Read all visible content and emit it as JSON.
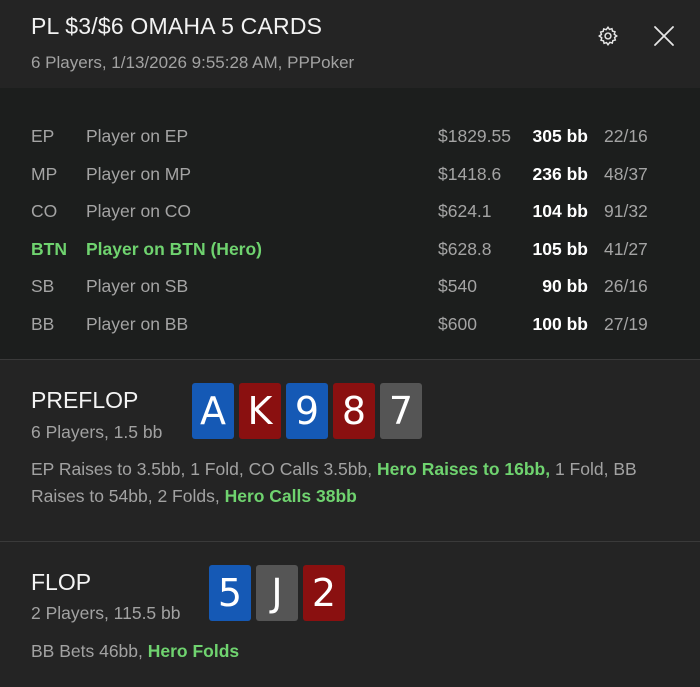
{
  "header": {
    "title": "PL $3/$6 OMAHA 5 CARDS",
    "subtitle": "6 Players, 1/13/2026 9:55:28 AM, PPPoker",
    "settings_icon": "gear-icon",
    "close_icon": "close-icon"
  },
  "players": [
    {
      "pos": "EP",
      "name": "Player on EP",
      "stack": "$1829.55",
      "bb": "305 bb",
      "stat": "22/16",
      "hero": false
    },
    {
      "pos": "MP",
      "name": "Player on MP",
      "stack": "$1418.6",
      "bb": "236 bb",
      "stat": "48/37",
      "hero": false
    },
    {
      "pos": "CO",
      "name": "Player on CO",
      "stack": "$624.1",
      "bb": "104 bb",
      "stat": "91/32",
      "hero": false
    },
    {
      "pos": "BTN",
      "name": "Player on BTN (Hero)",
      "stack": "$628.8",
      "bb": "105 bb",
      "stat": "41/27",
      "hero": true
    },
    {
      "pos": "SB",
      "name": "Player on SB",
      "stack": "$540",
      "bb": "90 bb",
      "stat": "26/16",
      "hero": false
    },
    {
      "pos": "BB",
      "name": "Player on BB",
      "stack": "$600",
      "bb": "100 bb",
      "stat": "27/19",
      "hero": false
    }
  ],
  "colors": {
    "hero_green": "#6fd36f",
    "suit_diamonds": "#1559b5",
    "suit_hearts": "#8a1010",
    "suit_spades": "#555555"
  },
  "streets": {
    "preflop": {
      "name": "PREFLOP",
      "info": "6 Players, 1.5 bb",
      "cards": [
        {
          "rank": "A",
          "suit": "d"
        },
        {
          "rank": "K",
          "suit": "h"
        },
        {
          "rank": "9",
          "suit": "d"
        },
        {
          "rank": "8",
          "suit": "h"
        },
        {
          "rank": "7",
          "suit": "s"
        }
      ],
      "actions": [
        {
          "text": "EP Raises to 3.5bb, 1 Fold, CO Calls 3.5bb, ",
          "hero": false
        },
        {
          "text": "Hero Raises to 16bb,",
          "hero": true
        },
        {
          "text": " 1 Fold, BB Raises to 54bb, 2 Folds, ",
          "hero": false
        },
        {
          "text": "Hero Calls 38bb",
          "hero": true
        }
      ]
    },
    "flop": {
      "name": "FLOP",
      "info": "2 Players, 115.5 bb",
      "cards": [
        {
          "rank": "5",
          "suit": "d"
        },
        {
          "rank": "J",
          "suit": "s"
        },
        {
          "rank": "2",
          "suit": "h"
        }
      ],
      "actions": [
        {
          "text": "BB Bets 46bb, ",
          "hero": false
        },
        {
          "text": "Hero Folds",
          "hero": true
        }
      ]
    }
  }
}
